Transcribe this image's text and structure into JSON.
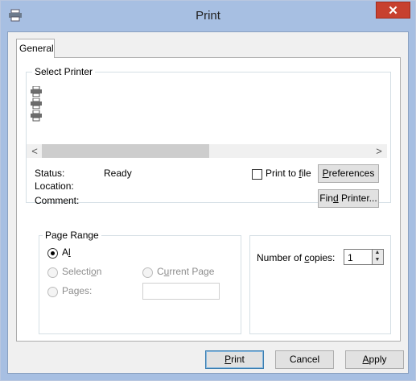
{
  "window": {
    "title": "Print",
    "close_label": "✕"
  },
  "tabs": [
    {
      "label": "General"
    }
  ],
  "select_printer": {
    "group_label": "Select Printer",
    "printers": [
      {
        "icon": "printer-icon"
      },
      {
        "icon": "printer-icon"
      },
      {
        "icon": "printer-icon"
      }
    ],
    "scroll_left": "<",
    "scroll_right": ">",
    "status_label": "Status:",
    "status_value": "Ready",
    "location_label": "Location:",
    "comment_label": "Comment:",
    "print_to_file_label_before": "Print to ",
    "print_to_file_label_accel": "f",
    "print_to_file_label_after": "ile",
    "preferences_accel": "P",
    "preferences_rest": "references",
    "find_printer_before": "Fin",
    "find_printer_accel": "d",
    "find_printer_after": " Printer..."
  },
  "page_range": {
    "group_label": "Page Range",
    "all_accel": "l",
    "all_before": "A",
    "all_after": "l",
    "selection_before": "Selecti",
    "selection_accel": "o",
    "selection_after": "n",
    "current_page_before": "C",
    "current_page_accel": "u",
    "current_page_after": "rrent Page",
    "pages_before": "Pa",
    "pages_accel": "g",
    "pages_after": "es:",
    "pages_value": "",
    "selected": "All"
  },
  "copies": {
    "label_before": "Number of ",
    "label_accel": "c",
    "label_after": "opies:",
    "value": "1"
  },
  "footer": {
    "print_accel": "P",
    "print_rest": "rint",
    "cancel_label": "Cancel",
    "apply_accel": "A",
    "apply_rest": "pply"
  },
  "colors": {
    "title_bar": "#a7bfe2",
    "close_button": "#c7402f",
    "dialog_background": "#f0f0f0"
  }
}
